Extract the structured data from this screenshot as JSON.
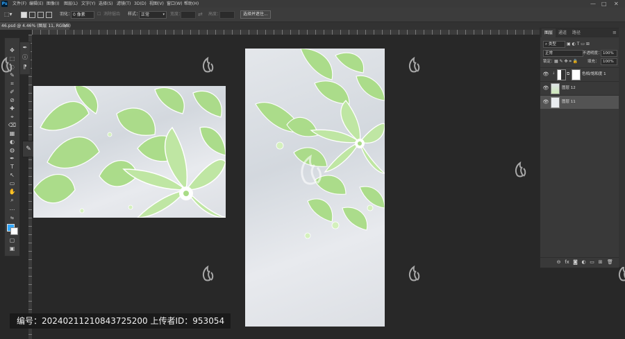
{
  "app": {
    "logo": "Ps"
  },
  "menu": [
    "文件(F)",
    "编辑(E)",
    "图像(I)",
    "图层(L)",
    "文字(Y)",
    "选择(S)",
    "滤镜(T)",
    "3D(D)",
    "视图(V)",
    "窗口(W)",
    "帮助(H)"
  ],
  "window_controls": {
    "minimize": "—",
    "maximize": "□",
    "close": "✕"
  },
  "options": {
    "feather_label": "羽化：",
    "feather_value": "0 像素",
    "antialias_label": "消除锯齿",
    "style_label": "样式：",
    "style_value": "正常",
    "width_label": "宽度：",
    "height_label": "高度：",
    "select_mask_button": "选择并遮住..."
  },
  "document_tab": {
    "title": "46.psd @ 4.46% (图层 11, RGB/8)",
    "close": "×"
  },
  "tools": [
    "✥",
    "⬚",
    "◌",
    "✎",
    "⌗",
    "✐",
    "⊘",
    "✚",
    "⌖",
    "⌫",
    "▦",
    "◐",
    "◍",
    "✒",
    "T",
    "↖",
    "▭",
    "✋",
    "⌕",
    "⋯",
    "⇆",
    "■",
    "▢",
    "▣"
  ],
  "tools_secondary": [
    "✒",
    "ⓘ",
    "⁋"
  ],
  "info_bar": {
    "text": "编号：20240211210843725200    上传者ID：953054"
  },
  "layers_panel": {
    "tabs": [
      "图层",
      "通道",
      "路径"
    ],
    "active_tab": 0,
    "filter_kind": "类型",
    "blend_mode": "正常",
    "opacity_label": "不透明度：",
    "opacity_value": "100%",
    "lock_label": "锁定：",
    "fill_label": "填充：",
    "fill_value": "100%",
    "layers": [
      {
        "name": "色相/饱和度 1",
        "visible": true,
        "selected": false,
        "kind": "adjustment"
      },
      {
        "name": "图层 12",
        "visible": true,
        "selected": false,
        "kind": "pattern"
      },
      {
        "name": "图层 11",
        "visible": true,
        "selected": true,
        "kind": "plain"
      }
    ],
    "footer_icons": [
      "link-icon",
      "fx-icon",
      "mask-icon",
      "adjustment-icon",
      "group-icon",
      "new-layer-icon",
      "trash-icon"
    ],
    "footer_glyphs": [
      "⊖",
      "fx",
      "◙",
      "◐",
      "▭",
      "⊞",
      "🗑"
    ]
  },
  "colors": {
    "accent_blue": "#31a8ff",
    "leaf_green": "#9ed87a",
    "panel": "#393939",
    "canvas": "#282828"
  }
}
